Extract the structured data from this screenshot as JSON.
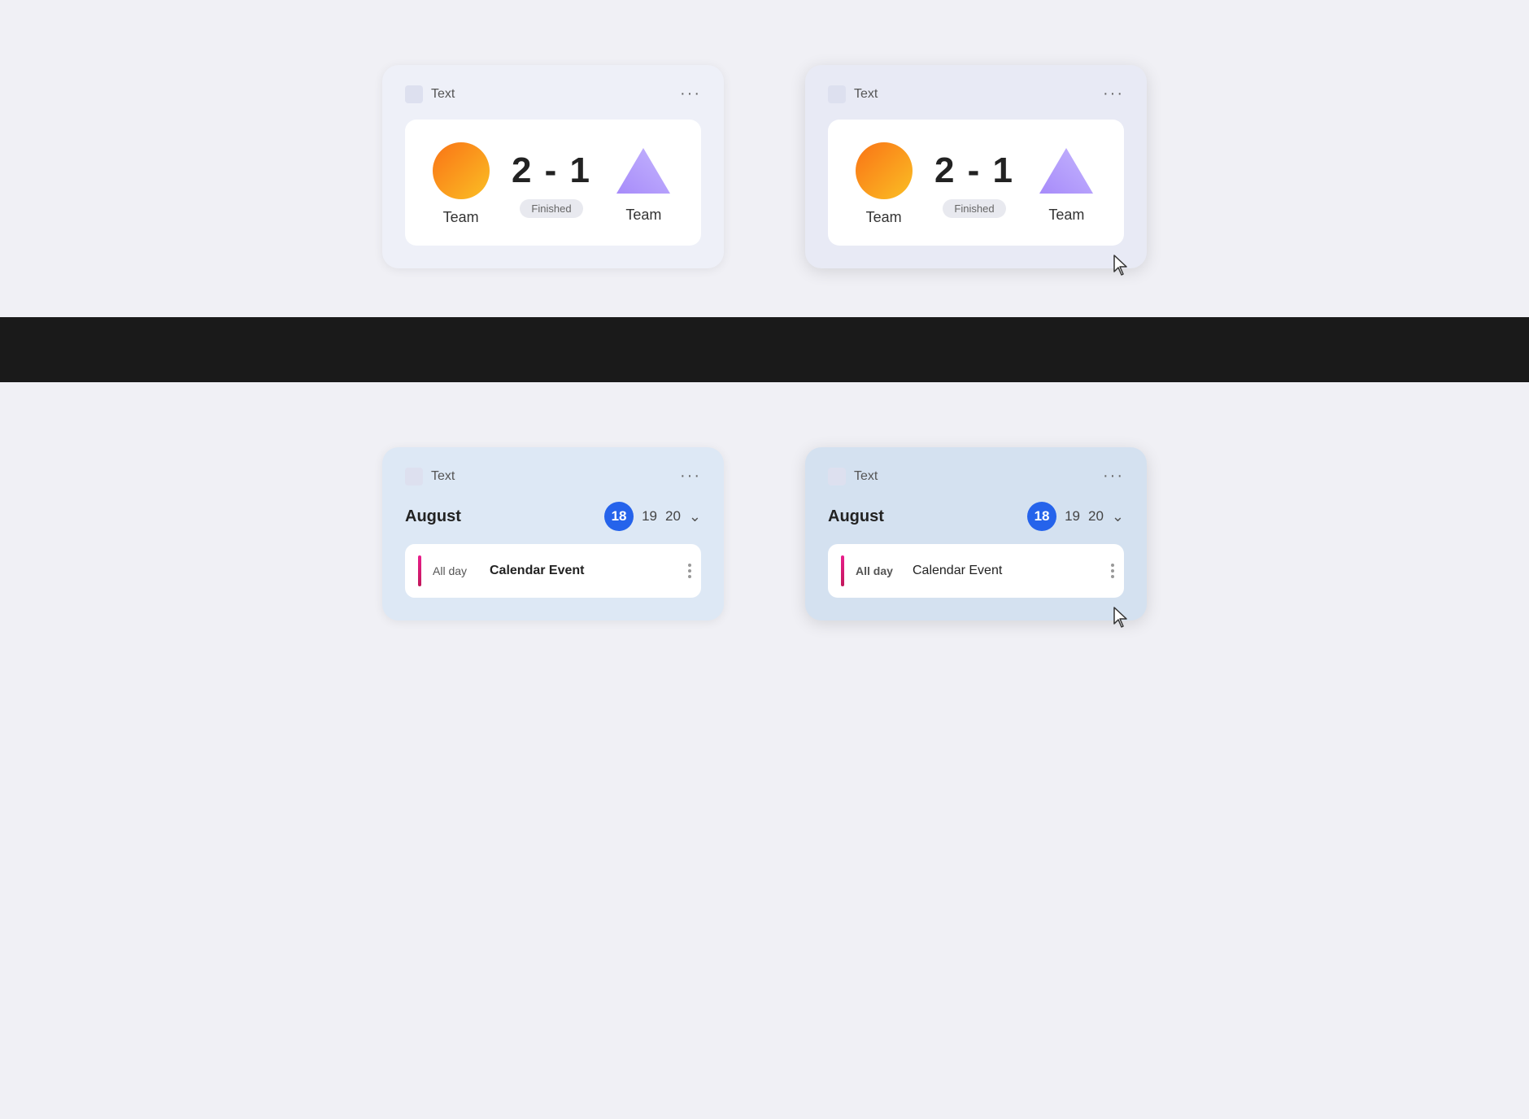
{
  "cards": {
    "score_card_left": {
      "header_text": "Text",
      "score": "2 - 1",
      "status": "Finished",
      "team1_name": "Team",
      "team2_name": "Team",
      "dots": "···"
    },
    "score_card_right": {
      "header_text": "Text",
      "score": "2 - 1",
      "status": "Finished",
      "team1_name": "Team",
      "team2_name": "Team",
      "dots": "···"
    },
    "calendar_card_left": {
      "header_text": "Text",
      "month": "August",
      "date1": "18",
      "date2": "19",
      "date3": "20",
      "allday": "All day",
      "event_title": "Calendar Event",
      "dots": "···"
    },
    "calendar_card_right": {
      "header_text": "Text",
      "month": "August",
      "date1": "18",
      "date2": "19",
      "date3": "20",
      "allday": "All day",
      "event_title": "Calendar Event",
      "dots": "···"
    }
  },
  "divider": {
    "bg": "#1a1a1a"
  }
}
